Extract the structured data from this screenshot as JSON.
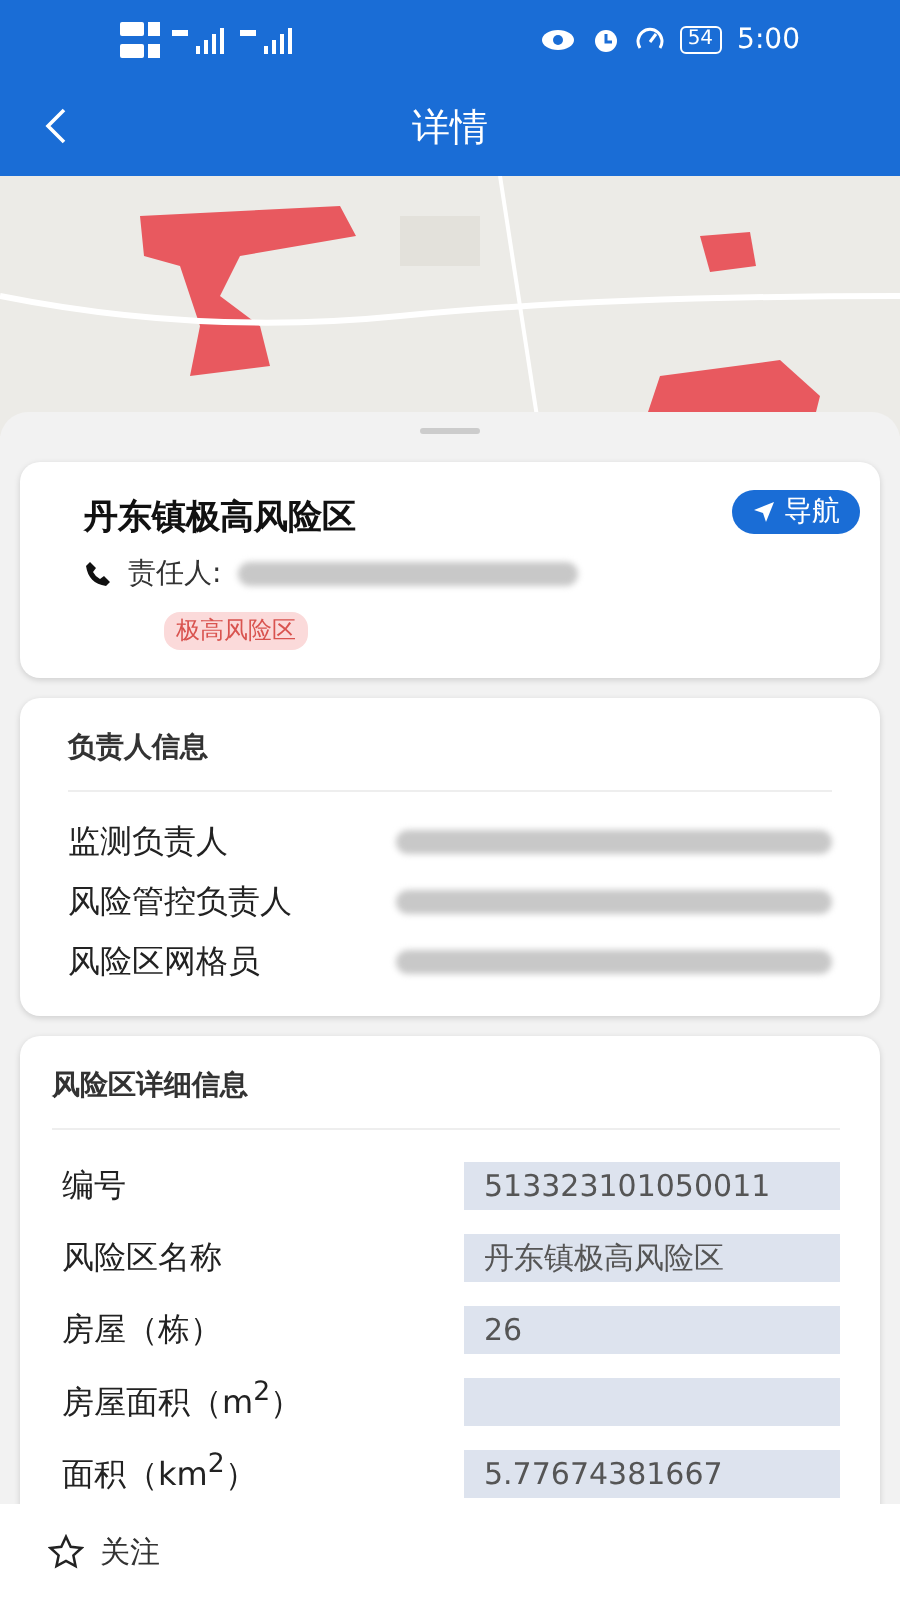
{
  "status_bar": {
    "battery": "54",
    "time": "5:00"
  },
  "header": {
    "title": "详情"
  },
  "summary": {
    "title": "丹东镇极高风险区",
    "nav_button": "导航",
    "contact_label": "责任人:",
    "tag": "极高风险区"
  },
  "responsible": {
    "title": "负责人信息",
    "rows": [
      {
        "label": "监测负责人"
      },
      {
        "label": "风险管控负责人"
      },
      {
        "label": "风险区网格员"
      }
    ]
  },
  "details": {
    "title": "风险区详细信息",
    "fields": [
      {
        "label": "编号",
        "value": "513323101050011"
      },
      {
        "label": "风险区名称",
        "value": "丹东镇极高风险区"
      },
      {
        "label": "房屋（栋）",
        "value": "26"
      },
      {
        "label": "房屋面积（m$^{2}$）"
      },
      {
        "label": "面积（km$^{2}$）",
        "value": "5.77674381667"
      }
    ]
  },
  "footer": {
    "follow": "关注",
    "followed": false
  }
}
